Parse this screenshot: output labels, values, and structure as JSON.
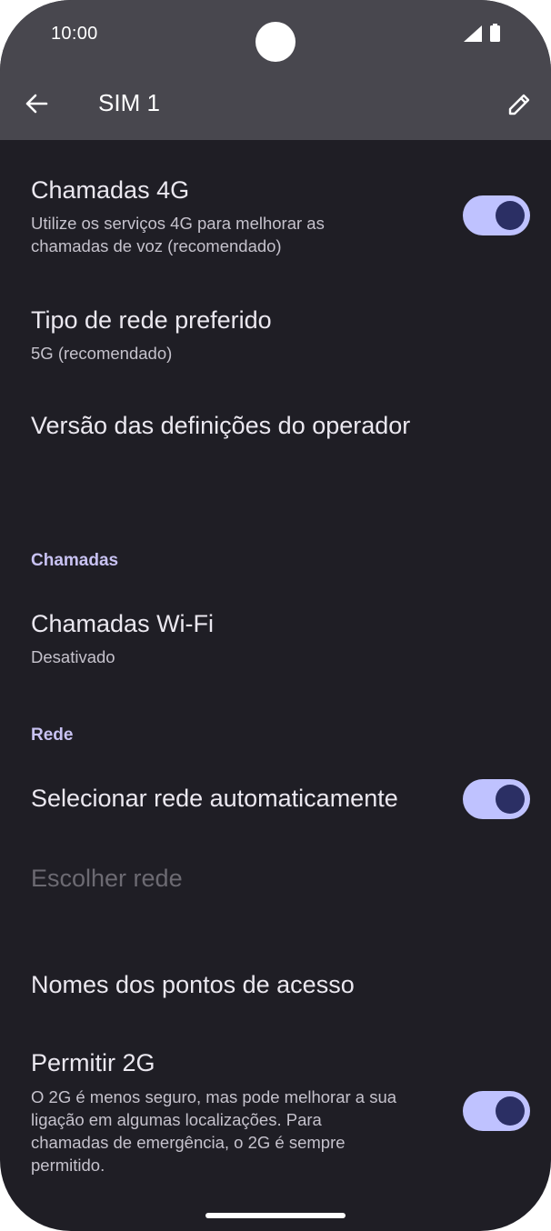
{
  "status_bar": {
    "time": "10:00"
  },
  "app_bar": {
    "title": "SIM 1",
    "back_icon": "arrow-back-icon",
    "edit_icon": "pencil-icon"
  },
  "settings": {
    "volte": {
      "title": "Chamadas 4G",
      "subtitle": "Utilize os serviços 4G para melhorar as chamadas de voz (recomendado)",
      "enabled": true
    },
    "network_type": {
      "title": "Tipo de rede preferido",
      "subtitle": "5G (recomendado)"
    },
    "carrier_version": {
      "title": "Versão das definições do operador"
    },
    "calls_header": "Chamadas",
    "wifi_calling": {
      "title": "Chamadas Wi-Fi",
      "subtitle": "Desativado"
    },
    "network_header": "Rede",
    "auto_network": {
      "title": "Selecionar rede automaticamente",
      "enabled": true
    },
    "choose_network": {
      "title": "Escolher rede"
    },
    "apn": {
      "title": "Nomes dos pontos de acesso"
    },
    "allow_2g": {
      "title": "Permitir 2G",
      "subtitle": "O 2G é menos seguro, mas pode melhorar a sua ligação em algumas localizações. Para chamadas de emergência, o 2G é sempre permitido.",
      "enabled": true
    }
  },
  "colors": {
    "background": "#1f1e25",
    "app_bar": "#48474e",
    "toggle_track": "#bfc2ff",
    "toggle_knob": "#2b2f64",
    "section_header": "#c8c2f2"
  }
}
